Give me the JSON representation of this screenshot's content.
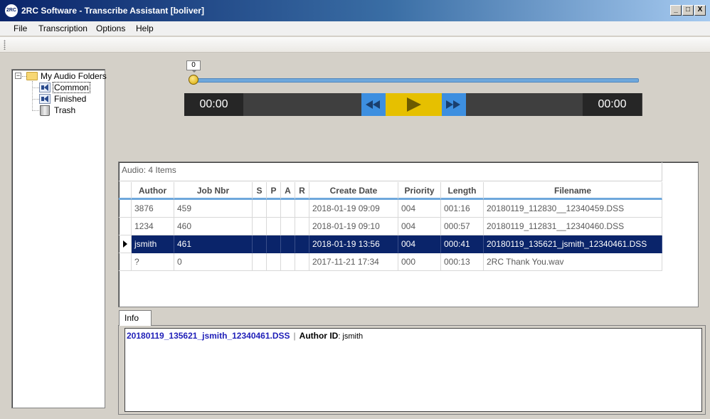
{
  "window": {
    "title": "2RC Software - Transcribe Assistant [boliver]",
    "app_icon_text": "2RC",
    "minimize": "_",
    "maximize": "□",
    "close": "X"
  },
  "menu": [
    {
      "label": "File"
    },
    {
      "label": "Transcription"
    },
    {
      "label": "Options"
    },
    {
      "label": "Help"
    }
  ],
  "tree": {
    "expander": "−",
    "root": "My Audio Folders",
    "children": [
      {
        "label": "Common",
        "icon": "speaker-folder-icon",
        "selected": true
      },
      {
        "label": "Finished",
        "icon": "speaker-folder-icon"
      },
      {
        "label": "Trash",
        "icon": "trash-icon"
      }
    ]
  },
  "player": {
    "position_tip": "0",
    "position": 0,
    "elapsed": "00:00",
    "total": "00:00",
    "colors": {
      "transport": "#3d8fe0",
      "play": "#e6c000"
    }
  },
  "grid": {
    "caption": "Audio: 4 Items",
    "columns": [
      "Author",
      "Job Nbr",
      "S",
      "P",
      "A",
      "R",
      "Create Date",
      "Priority",
      "Length",
      "Filename"
    ],
    "rows": [
      [
        "3876",
        "459",
        "",
        "",
        "",
        "",
        "2018-01-19 09:09",
        "004",
        "001:16",
        "20180119_112830__12340459.DSS"
      ],
      [
        "1234",
        "460",
        "",
        "",
        "",
        "",
        "2018-01-19 09:10",
        "004",
        "000:57",
        "20180119_112831__12340460.DSS"
      ],
      [
        "jsmith",
        "461",
        "",
        "",
        "",
        "",
        "2018-01-19 13:56",
        "004",
        "000:41",
        "20180119_135621_jsmith_12340461.DSS"
      ],
      [
        "?",
        "0",
        "",
        "",
        "",
        "",
        "2017-11-21 17:34",
        "000",
        "000:13",
        "2RC Thank You.wav"
      ]
    ],
    "selected_row": 2,
    "selection_color": "#0a246a"
  },
  "info": {
    "tab_label": "Info",
    "filename": "20180119_135621_jsmith_12340461.DSS",
    "separator": "|",
    "author_label": "Author ID",
    "author_value": ": jsmith"
  }
}
